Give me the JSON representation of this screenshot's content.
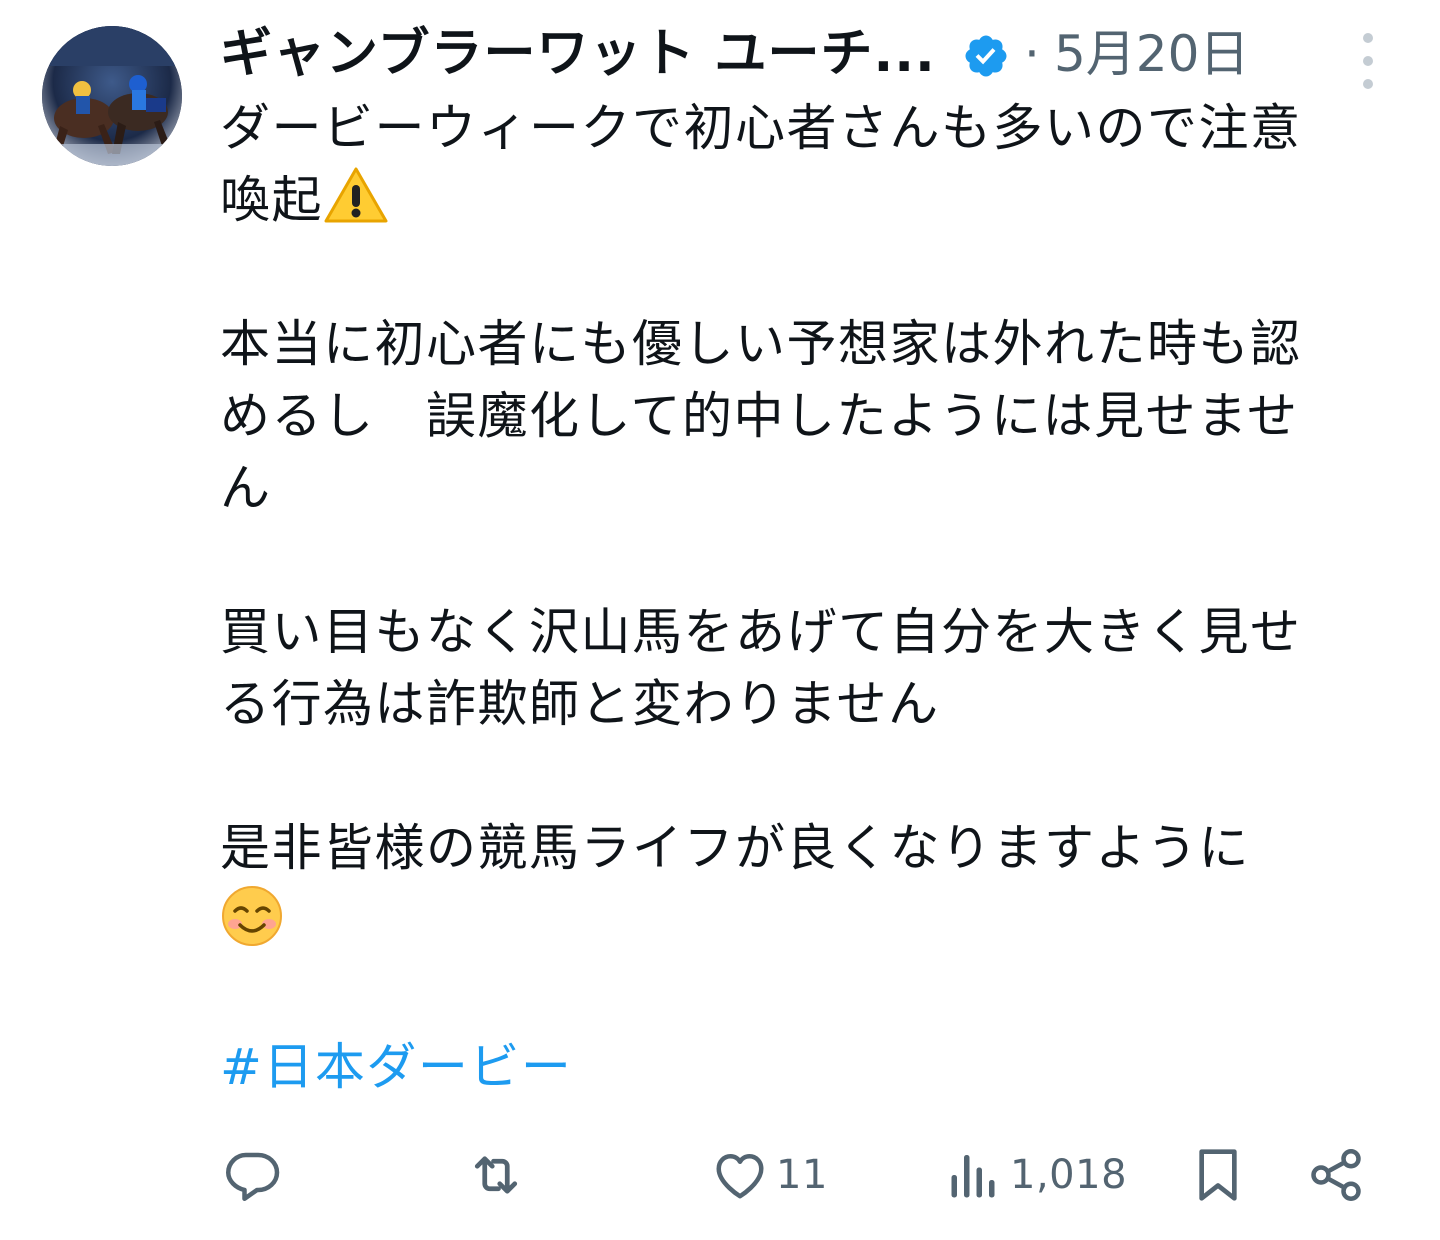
{
  "tweet": {
    "display_name": "ギャンブラーワット ユーチ...",
    "separator": "·",
    "date": "5月20日",
    "body": {
      "p1_line1": "ダービーウィークで初心者さんも多いので注意",
      "p1_line2": "喚起",
      "p1_emoji": "warning-emoji",
      "p2_line1": "本当に初心者にも優しい予想家は外れた時も認",
      "p2_line2": "めるし　誤魔化して的中したようには見せませ",
      "p2_line3": "ん",
      "p3_line1": "買い目もなく沢山馬をあげて自分を大きく見せ",
      "p3_line2": "る行為は詐欺師と変わりません",
      "p4_line1": "是非皆様の競馬ライフが良くなりますように",
      "p4_emoji": "smiling-face-emoji",
      "hashtag": "#日本ダービー"
    },
    "metrics": {
      "likes": "11",
      "views": "1,018"
    },
    "colors": {
      "text": "#0f1419",
      "secondary": "#536471",
      "accent": "#1d9bf0"
    },
    "icons": [
      "reply-icon",
      "retweet-icon",
      "like-icon",
      "views-icon",
      "bookmark-icon",
      "share-icon",
      "verified-badge-icon",
      "more-icon"
    ]
  }
}
